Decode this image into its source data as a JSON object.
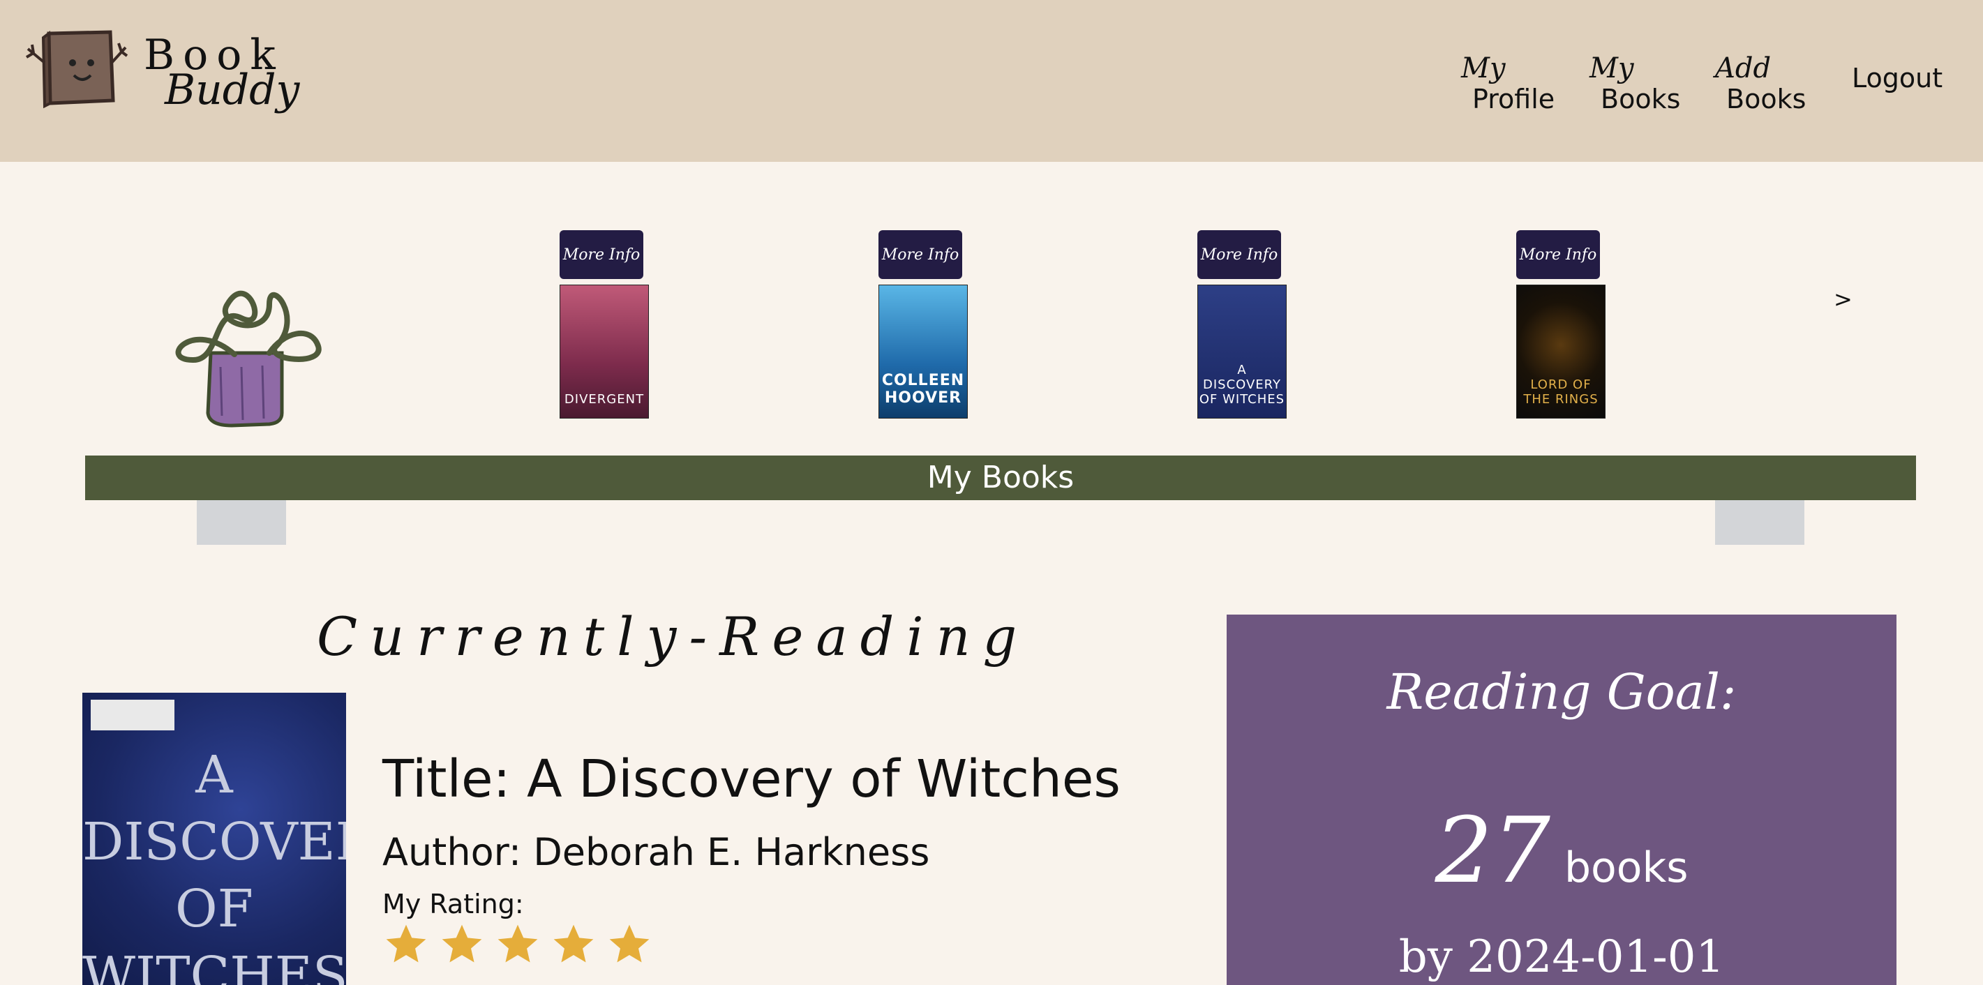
{
  "brand": {
    "line1": "Book",
    "line2": "Buddy"
  },
  "nav": {
    "profile": {
      "l1": "My",
      "l2": "Profile"
    },
    "books": {
      "l1": "My",
      "l2": "Books"
    },
    "add": {
      "l1": "Add",
      "l2": "Books"
    },
    "logout": "Logout"
  },
  "shelf": {
    "more_info_label": "More Info",
    "books": [
      {
        "title": "DIVERGENT"
      },
      {
        "title": "COLLEEN HOOVER"
      },
      {
        "title": "A DISCOVERY OF WITCHES"
      },
      {
        "title": "LORD OF THE RINGS"
      }
    ],
    "next_label": ">",
    "label": "My Books"
  },
  "currently_reading": {
    "heading": "Currently-Reading",
    "cover_title": "A DISCOVERY OF WITCHES",
    "title": "Title: A Discovery of Witches",
    "author": "Author: Deborah E. Harkness",
    "rating_label": "My Rating:",
    "rating": 5,
    "rating_max": 5
  },
  "goal": {
    "heading": "Reading Goal:",
    "count": "27",
    "unit": "books",
    "by": "by 2024-01-01"
  },
  "colors": {
    "header_bg": "#e0d1bd",
    "page_bg": "#f9f3ec",
    "shelf_green": "#4f5a3a",
    "button_navy": "#231c44",
    "goal_purple": "#6e5680",
    "star_gold": "#e5ad3a"
  }
}
